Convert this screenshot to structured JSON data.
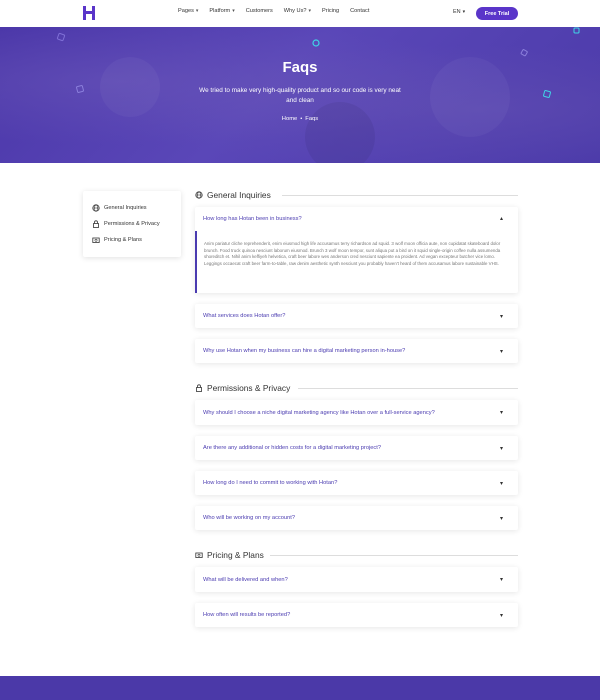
{
  "header": {
    "nav": [
      {
        "label": "Pages",
        "caret": "▾"
      },
      {
        "label": "Platform",
        "caret": "▾"
      },
      {
        "label": "Customers",
        "caret": ""
      },
      {
        "label": "Why Us?",
        "caret": "▾"
      },
      {
        "label": "Pricing",
        "caret": ""
      },
      {
        "label": "Contact",
        "caret": ""
      }
    ],
    "lang": "EN",
    "cta": "Free Trial"
  },
  "hero": {
    "title": "Faqs",
    "subtitle": "We tried to make very high-quality product and so our code is very neat and clean",
    "breadcrumb": {
      "home": "Home",
      "sep": "•",
      "current": "Faqs"
    }
  },
  "sidebar": {
    "items": [
      {
        "label": "General Inquiries",
        "icon": "globe-icon"
      },
      {
        "label": "Permissions & Privacy",
        "icon": "lock-icon"
      },
      {
        "label": "Pricing & Plans",
        "icon": "money-icon"
      }
    ]
  },
  "sections": {
    "general": {
      "title": "General Inquiries",
      "open": {
        "question": "How long has Hotan been in business?",
        "answer": "Anim pariatur cliche reprehenderit, enim eiusmod high life accusamus terry richardson ad squid. 3 wolf moon officia aute, non cupidatat skateboard dolor brunch. Food truck quinoa nesciunt laborum eiusmod. Brunch 3 wolf moon tempor, sunt aliqua put a bird on it squid single-origin coffee nulla assumenda shoreditch et. Nihil anim keffiyeh helvetica, craft beer labore wes anderson cred nesciunt sapiente ea proident. Ad vegan excepteur butcher vice lomo. Leggings occaecat craft beer farm-to-table, raw denim aesthetic synth nesciunt you probably haven't heard of them accusamus labore sustainable VHS."
      },
      "questions": [
        "What services does Hotan offer?",
        "Why use Hotan when my business can hire a digital marketing person in-house?"
      ]
    },
    "privacy": {
      "title": "Permissions & Privacy",
      "questions": [
        "Why should I choose a niche digital marketing agency like Hotan over a full-service agency?",
        "Are there any additional or hidden costs for a digital marketing project?",
        "How long do I need to commit to working with Hotan?",
        "Who will be working on my account?"
      ]
    },
    "pricing": {
      "title": "Pricing & Plans",
      "questions": [
        "What will be delivered and when?",
        "How often will results be reported?"
      ]
    }
  },
  "icons": {
    "open_chevron": "▴",
    "closed_chevron": "▾"
  },
  "colors": {
    "brand": "#5a35c9",
    "hero": "#4a36a8",
    "question_text": "#4a3bb0"
  }
}
